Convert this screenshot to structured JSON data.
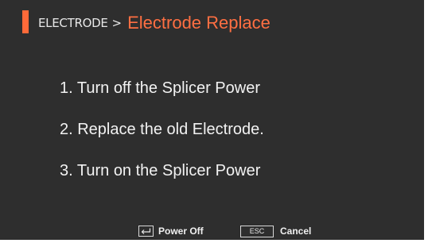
{
  "header": {
    "parent": "ELECTRODE",
    "separator": ">",
    "title": "Electrode Replace",
    "accent_color": "#ff6a39"
  },
  "steps": [
    "1. Turn off the Splicer Power",
    "2. Replace the old Electrode.",
    "3. Turn on the Splicer Power"
  ],
  "footer": {
    "enter_icon": "enter-arrow-icon",
    "enter_label": "Power Off",
    "esc_key": "ESC",
    "esc_label": "Cancel"
  }
}
